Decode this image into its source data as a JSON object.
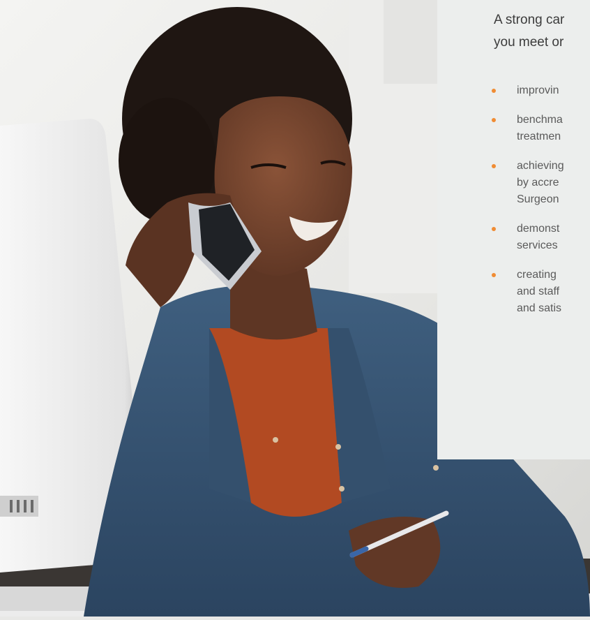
{
  "card": {
    "intro_lines": [
      "A strong car",
      "you meet or"
    ],
    "bullets": [
      {
        "lines": [
          "improvin"
        ]
      },
      {
        "lines": [
          "benchma",
          "treatmen"
        ]
      },
      {
        "lines": [
          "achieving",
          "by accre",
          "Surgeon"
        ]
      },
      {
        "lines": [
          "demonst",
          "services"
        ]
      },
      {
        "lines": [
          "creating",
          "and staff",
          "and satis"
        ]
      }
    ]
  },
  "colors": {
    "bullet": "#f08c34",
    "card_background": "#eceeed",
    "intro_text": "#3c3c3c",
    "list_text": "#5a5a5a"
  },
  "photo": {
    "icon": "person-on-phone-photo"
  }
}
